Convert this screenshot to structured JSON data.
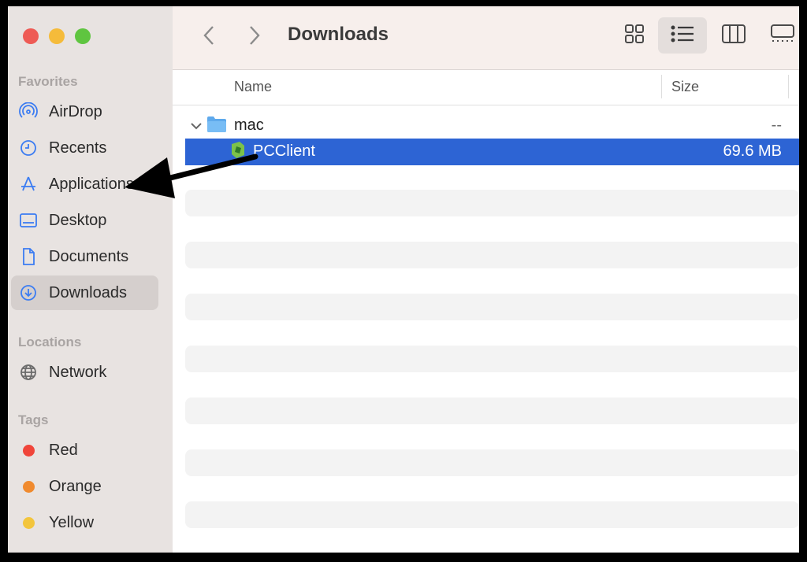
{
  "window": {
    "title": "Downloads"
  },
  "sidebar": {
    "favorites_title": "Favorites",
    "favorites": [
      {
        "label": "AirDrop",
        "icon": "airdrop-icon"
      },
      {
        "label": "Recents",
        "icon": "clock-icon"
      },
      {
        "label": "Applications",
        "icon": "applications-icon"
      },
      {
        "label": "Desktop",
        "icon": "desktop-icon"
      },
      {
        "label": "Documents",
        "icon": "document-icon"
      },
      {
        "label": "Downloads",
        "icon": "download-icon",
        "selected": true
      }
    ],
    "locations_title": "Locations",
    "locations": [
      {
        "label": "Network",
        "icon": "globe-icon"
      }
    ],
    "tags_title": "Tags",
    "tags": [
      {
        "label": "Red",
        "color": "#f0453a"
      },
      {
        "label": "Orange",
        "color": "#f08a2e"
      },
      {
        "label": "Yellow",
        "color": "#f3c53c"
      }
    ]
  },
  "columns": {
    "name": "Name",
    "size": "Size"
  },
  "files": [
    {
      "name": "mac",
      "size": "--",
      "type": "folder",
      "expanded": true
    },
    {
      "name": "PCClient",
      "size": "69.6 MB",
      "type": "app",
      "selected": true
    }
  ],
  "colors": {
    "accent": "#2d64d4",
    "sidebar_icon": "#3b7cf2",
    "arrow": "#000000"
  }
}
